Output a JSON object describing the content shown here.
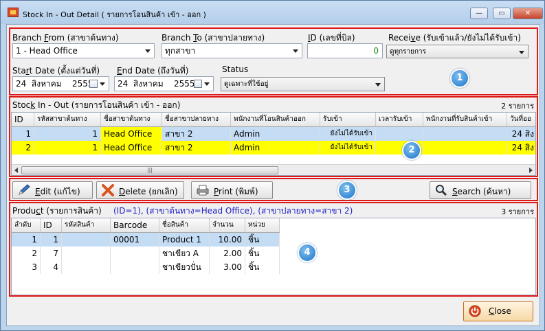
{
  "window": {
    "title": "Stock In - Out Detail ( รายการโอนสินค้า เข้า - ออก )",
    "minimize": "—",
    "maximize": "▭",
    "close": "✕"
  },
  "filters": {
    "branch_from": {
      "label_key": "F",
      "label_pre": "Branch ",
      "label_post": "rom (สาขาต้นทาง)",
      "value": "1 - Head Office"
    },
    "branch_to": {
      "label_key": "T",
      "label_pre": "Branch ",
      "label_post": "o (สาขาปลายทาง)",
      "value": "ทุกสาขา"
    },
    "id": {
      "label_key": "I",
      "label_post": "D (เลขที่บิล)",
      "value": "0"
    },
    "receive": {
      "label_pre": "Recei",
      "label_key": "v",
      "label_post": "e (รับเข้าแล้ว/ยังไม่ได้รับเข้า)",
      "value": "ดูทุกรายการ"
    },
    "start_date": {
      "label_pre": "Sta",
      "label_key": "r",
      "label_post": "t Date (ตั้งแต่วันที่)",
      "day": "24",
      "month": "สิงหาคม",
      "year": "2555"
    },
    "end_date": {
      "label_key": "E",
      "label_post": "nd Date (ถึงวันที่)",
      "day": "24",
      "month": "สิงหาคม",
      "year": "2555"
    },
    "status": {
      "label": "Status",
      "value": "ดูเฉพาะที่ใช้อยู่"
    },
    "badge": "1"
  },
  "stock_grid": {
    "title_pre": "Stoc",
    "title_key": "k",
    "title_post": " In - Out (รายการโอนสินค้า เข้า - ออก)",
    "count": "2 รายการ",
    "badge": "2",
    "columns": [
      "ID",
      "รหัสสาขาต้นทาง",
      "ชื่อสาขาต้นทาง",
      "ชื่อสาขาปลายทาง",
      "พนักงานที่โอนสินค้าออก",
      "รับเข้า",
      "เวลารับเข้า",
      "พนักงานที่รับสินค้าเข้า",
      "วันที่ออ"
    ],
    "rows": [
      {
        "id": "1",
        "from_code": "1",
        "from_name": "Head Office",
        "to_name": "สาขา 2",
        "employee": "Admin",
        "received": "ยังไม่ได้รับเข้า",
        "recv_time": "",
        "recv_emp": "",
        "date": "24 สิง"
      },
      {
        "id": "2",
        "from_code": "1",
        "from_name": "Head Office",
        "to_name": "สาขา 2",
        "employee": "Admin",
        "received": "ยังไม่ได้รับเข้า",
        "recv_time": "",
        "recv_emp": "",
        "date": "24 สิง"
      }
    ],
    "scroll_thumb": "|||"
  },
  "actions": {
    "edit_key": "E",
    "edit_post": "dit (แก้ไข)",
    "delete_key": "D",
    "delete_post": "elete (ยกเลิก)",
    "print_key": "P",
    "print_post": "rint (พิมพ์)",
    "search_key": "S",
    "search_post": "earch (ค้นหา)",
    "badge": "3"
  },
  "product_grid": {
    "title_pre": "Produ",
    "title_key": "c",
    "title_post": "t (รายการสินค้า)",
    "filter_info": "(ID=1), (สาขาต้นทาง=Head Office), (สาขาปลายทาง=สาขา 2)",
    "count": "3 รายการ",
    "badge": "4",
    "columns": [
      "ลำดับ",
      "ID",
      "รหัสสินค้า",
      "Barcode",
      "ชื่อสินค้า",
      "จำนวน",
      "หน่วย"
    ],
    "rows": [
      {
        "seq": "1",
        "id": "1",
        "code": "",
        "barcode": "00001",
        "name": "Product 1",
        "qty": "10.00",
        "unit": "ชิ้น"
      },
      {
        "seq": "2",
        "id": "7",
        "code": "",
        "barcode": "",
        "name": "ชาเขียว A",
        "qty": "2.00",
        "unit": "ชิ้น"
      },
      {
        "seq": "3",
        "id": "4",
        "code": "",
        "barcode": "",
        "name": "ชาเขียวปั่น",
        "qty": "3.00",
        "unit": "ชิ้น"
      }
    ]
  },
  "close_button": {
    "key": "C",
    "post": "lose"
  },
  "colors": {
    "accent_red": "#e01818",
    "selected_row": "#c4dcf4",
    "highlight_row": "#ffff00",
    "badge_blue": "#1e74c8"
  }
}
